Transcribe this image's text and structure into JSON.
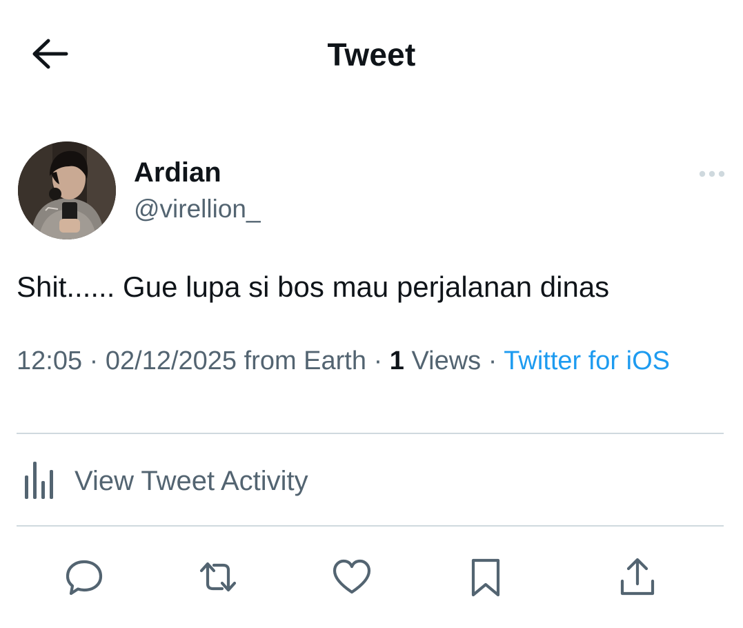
{
  "header": {
    "title": "Tweet",
    "back_icon": "arrow-left-icon"
  },
  "author": {
    "display_name": "Ardian",
    "handle": "@virellion_",
    "more_icon": "more-horizontal-icon"
  },
  "tweet": {
    "text": "Shit...... Gue lupa si bos mau perjalanan dinas"
  },
  "meta": {
    "time": "12:05",
    "separator": " · ",
    "date": "02/12/2025",
    "location": " from Earth",
    "views_count": "1",
    "views_label": " Views",
    "source": "Twitter for iOS"
  },
  "activity": {
    "label": "View Tweet Activity",
    "icon": "bar-chart-icon"
  },
  "actions": {
    "reply_icon": "reply-icon",
    "retweet_icon": "retweet-icon",
    "like_icon": "heart-icon",
    "bookmark_icon": "bookmark-icon",
    "share_icon": "share-icon"
  },
  "colors": {
    "text_primary": "#0f1419",
    "text_secondary": "#536471",
    "link": "#1d9bf0",
    "divider": "#cfd9de",
    "background": "#ffffff"
  }
}
